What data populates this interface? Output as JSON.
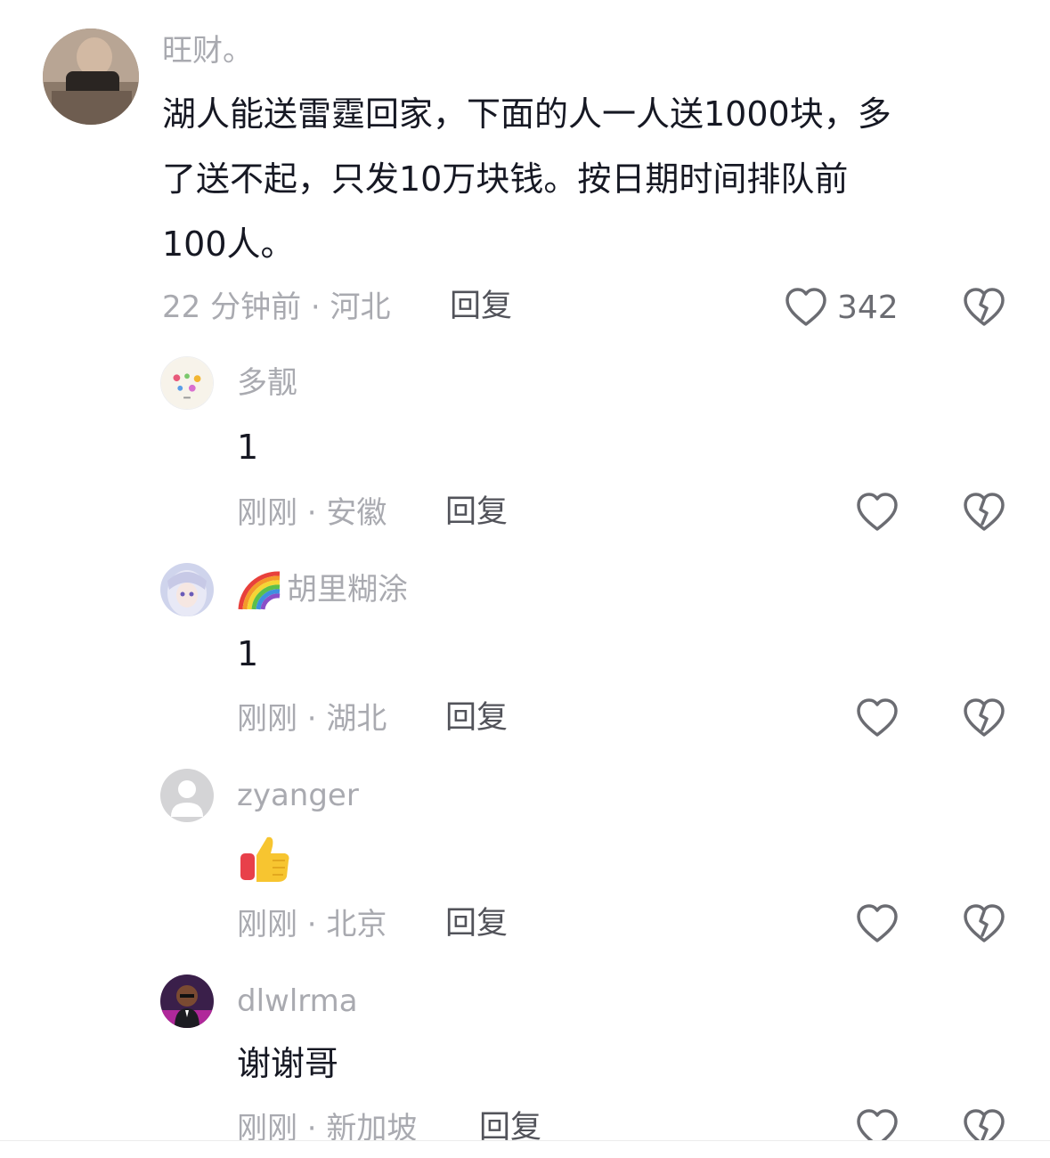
{
  "comments": [
    {
      "username": "旺财。",
      "lines": [
        "湖人能送雷霆回家，下面的人一人送1000块，多",
        "了送不起，只发10万块钱。按日期时间排队前",
        "100人。"
      ],
      "meta": "22 分钟前 · 河北",
      "reply": "回复",
      "likes": "342",
      "avatar_icon": "photo-avatar",
      "like_icon": "heart-outline-icon",
      "dislike_icon": "broken-heart-icon"
    }
  ],
  "replies": [
    {
      "username": "多靓",
      "text": "1",
      "meta": "刚刚 · 安徽",
      "reply": "回复",
      "avatar_icon": "sticker-avatar"
    },
    {
      "username_prefix_icon": "rainbow-icon",
      "username": "胡里糊涂",
      "text": "1",
      "meta": "刚刚 · 湖北",
      "reply": "回复",
      "avatar_icon": "anime-girl-avatar"
    },
    {
      "username": "zyanger",
      "text_icon": "thumbs-up-emoji",
      "meta": "刚刚 · 北京",
      "reply": "回复",
      "avatar_icon": "default-user-avatar"
    },
    {
      "username": "dlwlrma",
      "text": "谢谢哥",
      "meta": "刚刚 · 新加坡",
      "reply": "回复",
      "avatar_icon": "cartoon-avatar"
    }
  ],
  "colors": {
    "username": "#a9aab0",
    "body": "#161823",
    "reply": "#52535a",
    "icon": "#6b6c72"
  }
}
